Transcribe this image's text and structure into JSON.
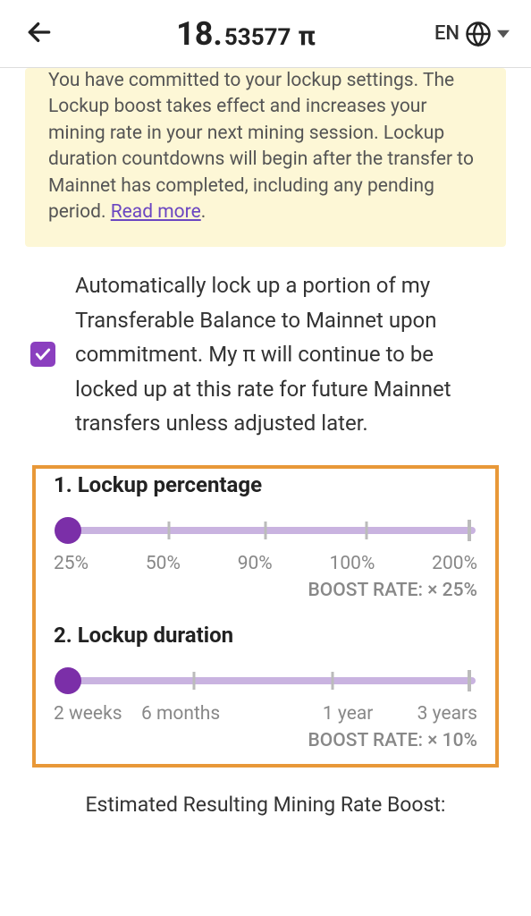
{
  "header": {
    "balance_int": "18.",
    "balance_dec": "53577",
    "balance_sym": "π",
    "lang": "EN"
  },
  "info": {
    "text": "You have committed to your lockup settings. The Lockup boost takes effect and increases your mining rate in your next mining session. Lockup duration countdowns will begin after the transfer to Mainnet has completed, including any pending period. ",
    "link": "Read more",
    "period": "."
  },
  "checkbox_label": "Automatically lock up a portion of my Transferable Balance to Mainnet upon commitment. My π will continue to be locked up at this rate for future Mainnet transfers unless adjusted later.",
  "lockup_percentage": {
    "title": "1. Lockup percentage",
    "labels": [
      "25%",
      "50%",
      "90%",
      "100%",
      "200%"
    ],
    "boost": "BOOST RATE: × 25%"
  },
  "lockup_duration": {
    "title": "2. Lockup duration",
    "labels": [
      "2 weeks",
      "6 months",
      "1 year",
      "3 years"
    ],
    "boost": "BOOST RATE: × 10%"
  },
  "estimate": "Estimated Resulting Mining Rate Boost:"
}
